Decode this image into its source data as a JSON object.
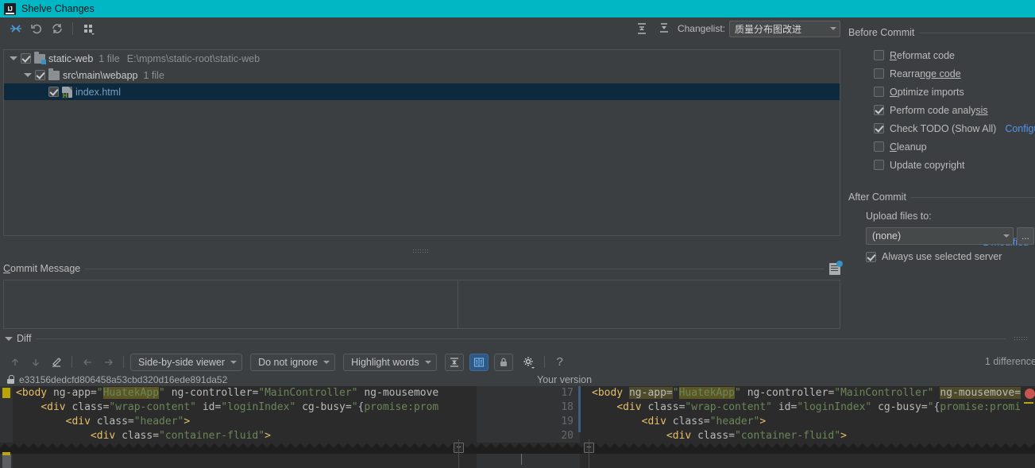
{
  "window": {
    "title": "Shelve Changes",
    "logo_text": "IJ"
  },
  "toolbar": {
    "buttons": [
      {
        "name": "collapse-all-icon",
        "label": ""
      },
      {
        "name": "rollback-icon",
        "label": ""
      },
      {
        "name": "refresh-icon",
        "label": ""
      },
      {
        "name": "group-by-icon",
        "label": ""
      }
    ],
    "expand_all_label": "",
    "collapse_all_label": "",
    "changelist_label": "Changelist:",
    "changelist_value": "质量分布图改进"
  },
  "tree": {
    "rows": [
      {
        "name": "static-web",
        "meta": "1 file",
        "path": "E:\\mpms\\static-root\\static-web",
        "checked": true,
        "indent": 0
      },
      {
        "name": "src\\main\\webapp",
        "meta": "1 file",
        "path": "",
        "checked": true,
        "indent": 1
      },
      {
        "name": "index.html",
        "meta": "",
        "path": "",
        "checked": true,
        "indent": 2
      }
    ],
    "modified_count": "1 modified"
  },
  "commit_message": {
    "label_head": "C",
    "label_rest": "ommit Message",
    "value": ""
  },
  "right_panel": {
    "before_commit": {
      "title": "Before Commit",
      "options": [
        {
          "pre": "R",
          "post": "eformat code",
          "checked": false,
          "link": ""
        },
        {
          "pre": "Rearra",
          "post": "nge code",
          "checked": false,
          "link": ""
        },
        {
          "pre": "O",
          "post": "ptimize imports",
          "checked": false,
          "link": ""
        },
        {
          "pre": "Perform code analy",
          "post": "sis",
          "checked": true,
          "link": ""
        },
        {
          "pre": "Check TODO (Show All)",
          "post": "",
          "checked": true,
          "link": "Configure"
        },
        {
          "pre": "C",
          "post": "leanup",
          "checked": false,
          "link": ""
        },
        {
          "pre": "Update copyright",
          "post": "",
          "checked": false,
          "link": ""
        }
      ]
    },
    "after_commit": {
      "title": "After Commit",
      "upload_label": "Upload files to:",
      "upload_value": "(none)",
      "browse_label": "...",
      "always_use_label": "Always use selected server",
      "always_use_checked": true
    }
  },
  "diff": {
    "section_title": "Diff",
    "viewer_mode": "Side-by-side viewer",
    "ignore_mode": "Do not ignore",
    "highlight_mode": "Highlight words",
    "help_label": "?",
    "difference_count": "1 difference",
    "revision_hash": "e33156dedcfd806458a53cbd320d16ede891da52",
    "your_version_label": "Your version",
    "line_numbers_left": [
      "17",
      "18",
      "19",
      "20"
    ],
    "line_numbers_right": [
      "17",
      "18",
      "19",
      "20"
    ],
    "code_lines": [
      "<body ng-app=\"HuatekApp\" ng-controller=\"MainController\" ng-mousemove",
      "    <div class=\"wrap-content\" id=\"loginIndex\" cg-busy=\"{promise:prom",
      "        <div class=\"header\">",
      "            <div class=\"container-fluid\">"
    ],
    "code_lines_right": [
      "<body ng-app=\"HuatekApp\" ng-controller=\"MainController\" ng-mousemove=",
      "    <div class=\"wrap-content\" id=\"loginIndex\" cg-busy=\"{promise:promi",
      "        <div class=\"header\">",
      "            <div class=\"container-fluid\">"
    ]
  },
  "colors": {
    "title_bar": "#00b7c3",
    "accent_link": "#5394ec",
    "panel_bg": "#3c3f41",
    "editor_bg": "#2b2b2b",
    "selection": "#0d293e"
  }
}
